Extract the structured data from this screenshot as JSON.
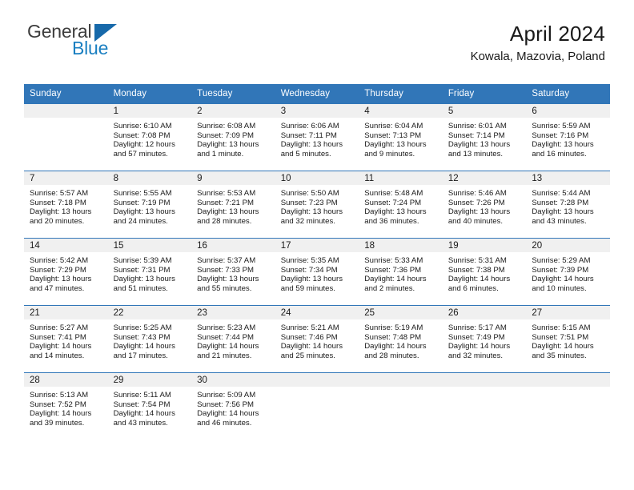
{
  "brand": {
    "line1": "General",
    "line2": "Blue",
    "accent_color": "#1769aa",
    "text_color": "#3d3d3d"
  },
  "header": {
    "title": "April 2024",
    "subtitle": "Kowala, Mazovia, Poland"
  },
  "calendar": {
    "header_bg": "#3176b8",
    "header_text_color": "#ffffff",
    "band_bg": "#f0f0f0",
    "weekday_headers": [
      "Sunday",
      "Monday",
      "Tuesday",
      "Wednesday",
      "Thursday",
      "Friday",
      "Saturday"
    ],
    "weeks": [
      [
        {
          "day": "",
          "sunrise": "",
          "sunset": "",
          "daylight_line1": "",
          "daylight_line2": ""
        },
        {
          "day": "1",
          "sunrise": "Sunrise: 6:10 AM",
          "sunset": "Sunset: 7:08 PM",
          "daylight_line1": "Daylight: 12 hours",
          "daylight_line2": "and 57 minutes."
        },
        {
          "day": "2",
          "sunrise": "Sunrise: 6:08 AM",
          "sunset": "Sunset: 7:09 PM",
          "daylight_line1": "Daylight: 13 hours",
          "daylight_line2": "and 1 minute."
        },
        {
          "day": "3",
          "sunrise": "Sunrise: 6:06 AM",
          "sunset": "Sunset: 7:11 PM",
          "daylight_line1": "Daylight: 13 hours",
          "daylight_line2": "and 5 minutes."
        },
        {
          "day": "4",
          "sunrise": "Sunrise: 6:04 AM",
          "sunset": "Sunset: 7:13 PM",
          "daylight_line1": "Daylight: 13 hours",
          "daylight_line2": "and 9 minutes."
        },
        {
          "day": "5",
          "sunrise": "Sunrise: 6:01 AM",
          "sunset": "Sunset: 7:14 PM",
          "daylight_line1": "Daylight: 13 hours",
          "daylight_line2": "and 13 minutes."
        },
        {
          "day": "6",
          "sunrise": "Sunrise: 5:59 AM",
          "sunset": "Sunset: 7:16 PM",
          "daylight_line1": "Daylight: 13 hours",
          "daylight_line2": "and 16 minutes."
        }
      ],
      [
        {
          "day": "7",
          "sunrise": "Sunrise: 5:57 AM",
          "sunset": "Sunset: 7:18 PM",
          "daylight_line1": "Daylight: 13 hours",
          "daylight_line2": "and 20 minutes."
        },
        {
          "day": "8",
          "sunrise": "Sunrise: 5:55 AM",
          "sunset": "Sunset: 7:19 PM",
          "daylight_line1": "Daylight: 13 hours",
          "daylight_line2": "and 24 minutes."
        },
        {
          "day": "9",
          "sunrise": "Sunrise: 5:53 AM",
          "sunset": "Sunset: 7:21 PM",
          "daylight_line1": "Daylight: 13 hours",
          "daylight_line2": "and 28 minutes."
        },
        {
          "day": "10",
          "sunrise": "Sunrise: 5:50 AM",
          "sunset": "Sunset: 7:23 PM",
          "daylight_line1": "Daylight: 13 hours",
          "daylight_line2": "and 32 minutes."
        },
        {
          "day": "11",
          "sunrise": "Sunrise: 5:48 AM",
          "sunset": "Sunset: 7:24 PM",
          "daylight_line1": "Daylight: 13 hours",
          "daylight_line2": "and 36 minutes."
        },
        {
          "day": "12",
          "sunrise": "Sunrise: 5:46 AM",
          "sunset": "Sunset: 7:26 PM",
          "daylight_line1": "Daylight: 13 hours",
          "daylight_line2": "and 40 minutes."
        },
        {
          "day": "13",
          "sunrise": "Sunrise: 5:44 AM",
          "sunset": "Sunset: 7:28 PM",
          "daylight_line1": "Daylight: 13 hours",
          "daylight_line2": "and 43 minutes."
        }
      ],
      [
        {
          "day": "14",
          "sunrise": "Sunrise: 5:42 AM",
          "sunset": "Sunset: 7:29 PM",
          "daylight_line1": "Daylight: 13 hours",
          "daylight_line2": "and 47 minutes."
        },
        {
          "day": "15",
          "sunrise": "Sunrise: 5:39 AM",
          "sunset": "Sunset: 7:31 PM",
          "daylight_line1": "Daylight: 13 hours",
          "daylight_line2": "and 51 minutes."
        },
        {
          "day": "16",
          "sunrise": "Sunrise: 5:37 AM",
          "sunset": "Sunset: 7:33 PM",
          "daylight_line1": "Daylight: 13 hours",
          "daylight_line2": "and 55 minutes."
        },
        {
          "day": "17",
          "sunrise": "Sunrise: 5:35 AM",
          "sunset": "Sunset: 7:34 PM",
          "daylight_line1": "Daylight: 13 hours",
          "daylight_line2": "and 59 minutes."
        },
        {
          "day": "18",
          "sunrise": "Sunrise: 5:33 AM",
          "sunset": "Sunset: 7:36 PM",
          "daylight_line1": "Daylight: 14 hours",
          "daylight_line2": "and 2 minutes."
        },
        {
          "day": "19",
          "sunrise": "Sunrise: 5:31 AM",
          "sunset": "Sunset: 7:38 PM",
          "daylight_line1": "Daylight: 14 hours",
          "daylight_line2": "and 6 minutes."
        },
        {
          "day": "20",
          "sunrise": "Sunrise: 5:29 AM",
          "sunset": "Sunset: 7:39 PM",
          "daylight_line1": "Daylight: 14 hours",
          "daylight_line2": "and 10 minutes."
        }
      ],
      [
        {
          "day": "21",
          "sunrise": "Sunrise: 5:27 AM",
          "sunset": "Sunset: 7:41 PM",
          "daylight_line1": "Daylight: 14 hours",
          "daylight_line2": "and 14 minutes."
        },
        {
          "day": "22",
          "sunrise": "Sunrise: 5:25 AM",
          "sunset": "Sunset: 7:43 PM",
          "daylight_line1": "Daylight: 14 hours",
          "daylight_line2": "and 17 minutes."
        },
        {
          "day": "23",
          "sunrise": "Sunrise: 5:23 AM",
          "sunset": "Sunset: 7:44 PM",
          "daylight_line1": "Daylight: 14 hours",
          "daylight_line2": "and 21 minutes."
        },
        {
          "day": "24",
          "sunrise": "Sunrise: 5:21 AM",
          "sunset": "Sunset: 7:46 PM",
          "daylight_line1": "Daylight: 14 hours",
          "daylight_line2": "and 25 minutes."
        },
        {
          "day": "25",
          "sunrise": "Sunrise: 5:19 AM",
          "sunset": "Sunset: 7:48 PM",
          "daylight_line1": "Daylight: 14 hours",
          "daylight_line2": "and 28 minutes."
        },
        {
          "day": "26",
          "sunrise": "Sunrise: 5:17 AM",
          "sunset": "Sunset: 7:49 PM",
          "daylight_line1": "Daylight: 14 hours",
          "daylight_line2": "and 32 minutes."
        },
        {
          "day": "27",
          "sunrise": "Sunrise: 5:15 AM",
          "sunset": "Sunset: 7:51 PM",
          "daylight_line1": "Daylight: 14 hours",
          "daylight_line2": "and 35 minutes."
        }
      ],
      [
        {
          "day": "28",
          "sunrise": "Sunrise: 5:13 AM",
          "sunset": "Sunset: 7:52 PM",
          "daylight_line1": "Daylight: 14 hours",
          "daylight_line2": "and 39 minutes."
        },
        {
          "day": "29",
          "sunrise": "Sunrise: 5:11 AM",
          "sunset": "Sunset: 7:54 PM",
          "daylight_line1": "Daylight: 14 hours",
          "daylight_line2": "and 43 minutes."
        },
        {
          "day": "30",
          "sunrise": "Sunrise: 5:09 AM",
          "sunset": "Sunset: 7:56 PM",
          "daylight_line1": "Daylight: 14 hours",
          "daylight_line2": "and 46 minutes."
        },
        {
          "day": "",
          "sunrise": "",
          "sunset": "",
          "daylight_line1": "",
          "daylight_line2": ""
        },
        {
          "day": "",
          "sunrise": "",
          "sunset": "",
          "daylight_line1": "",
          "daylight_line2": ""
        },
        {
          "day": "",
          "sunrise": "",
          "sunset": "",
          "daylight_line1": "",
          "daylight_line2": ""
        },
        {
          "day": "",
          "sunrise": "",
          "sunset": "",
          "daylight_line1": "",
          "daylight_line2": ""
        }
      ]
    ]
  }
}
